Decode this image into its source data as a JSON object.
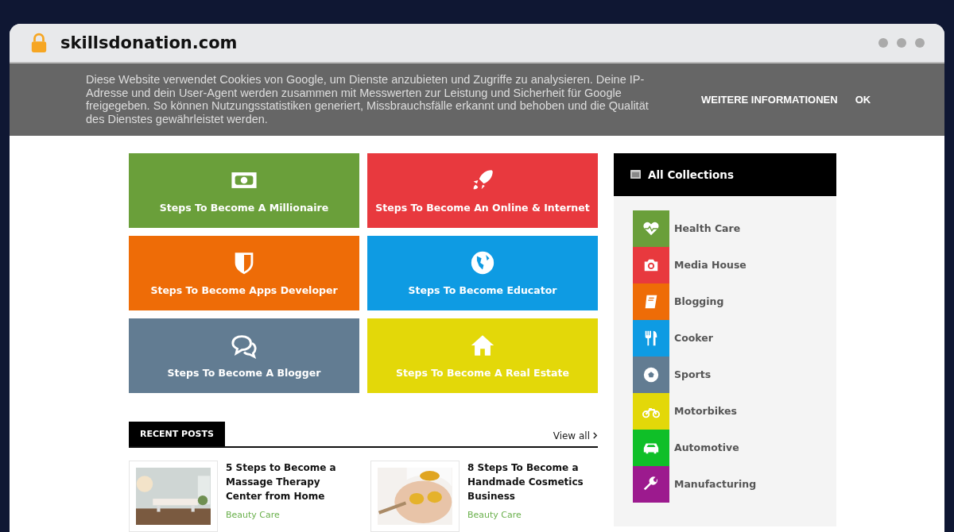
{
  "browser": {
    "url": "skillsdonation.com"
  },
  "cookie_banner": {
    "text": "Diese Website verwendet Cookies von Google, um Dienste anzubieten und Zugriffe zu analysieren. Deine IP-Adresse und dein User-Agent werden zusammen mit Messwerten zur Leistung und Sicherheit für Google freigegeben. So können Nutzungsstatistiken generiert, Missbrauchsfälle erkannt und behoben und die Qualität des Dienstes gewährleistet werden.",
    "buttons": [
      "WEITERE INFORMATIONEN",
      "OK"
    ]
  },
  "tiles": [
    {
      "label": "Steps To Become A Millionaire",
      "kind": "money",
      "color": "#6a9f3a"
    },
    {
      "label": "Steps To Become An Online & Internet",
      "kind": "rocket",
      "color": "#e8393e"
    },
    {
      "label": "Steps To Become Apps Developer",
      "kind": "shield",
      "color": "#ee6c07"
    },
    {
      "label": "Steps To Become Educator",
      "kind": "globe",
      "color": "#0e9be3"
    },
    {
      "label": "Steps To Become A Blogger",
      "kind": "chat",
      "color": "#627c92"
    },
    {
      "label": "Steps To Become A Real Estate",
      "kind": "house",
      "color": "#e3d809"
    }
  ],
  "recent_posts": {
    "title": "RECENT POSTS",
    "view_all": "View all",
    "posts": [
      {
        "title": "5 Steps to Become a Massage Therapy Center from Home",
        "category": "Beauty Care",
        "kind": "picture"
      },
      {
        "title": "8 Steps To Become a Handmade Cosmetics Business",
        "category": "Beauty Care",
        "kind": "picture"
      }
    ]
  },
  "sidebar": {
    "title": "All Collections",
    "items": [
      {
        "label": "Health Care",
        "kind": "heart",
        "color": "#6a9f3a"
      },
      {
        "label": "Media House",
        "kind": "camera",
        "color": "#e8393e"
      },
      {
        "label": "Blogging",
        "kind": "book",
        "color": "#ee6c07"
      },
      {
        "label": "Cooker",
        "kind": "cutlery",
        "color": "#0e9be3"
      },
      {
        "label": "Sports",
        "kind": "ball",
        "color": "#627c92"
      },
      {
        "label": "Motorbikes",
        "kind": "bike",
        "color": "#e3d809"
      },
      {
        "label": "Automotive",
        "kind": "car",
        "color": "#0fbf28"
      },
      {
        "label": "Manufacturing",
        "kind": "wrench",
        "color": "#9c1a8e"
      }
    ]
  }
}
